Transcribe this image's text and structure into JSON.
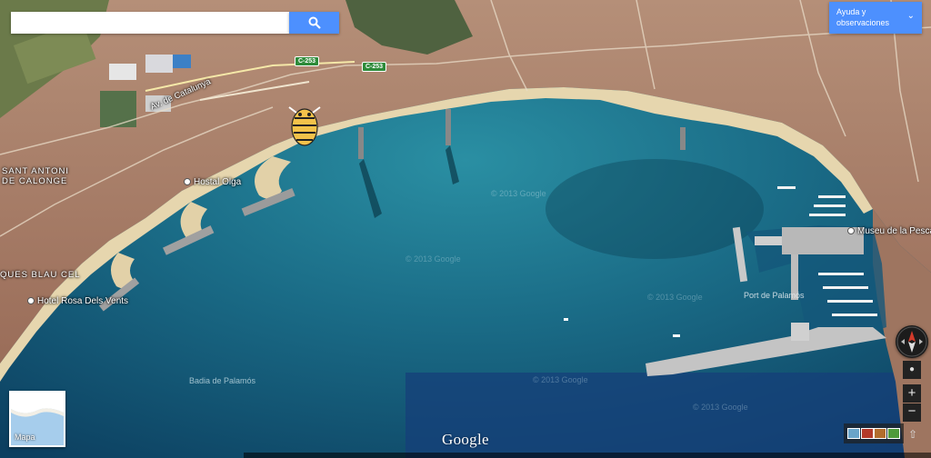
{
  "search": {
    "value": "",
    "placeholder": ""
  },
  "help_button": {
    "label_line1": "Ayuda y",
    "label_line2": "observaciones"
  },
  "road_shields": [
    "C-253",
    "C-253"
  ],
  "places": {
    "avenue": "Av. de Catalunya",
    "town_line1": "SANT ANTONI",
    "town_line2": "DE CALONGE",
    "hostal": "Hostal Olga",
    "hotel": "Hotel Rosa Dels Vents",
    "district": "QUES BLAU CEL",
    "museum": "Museu de la Pesca",
    "port": "Port de Palamós",
    "bay": "Badia de Palamós"
  },
  "watermarks": [
    "© 2013 Google",
    "© 2013 Google",
    "© 2013 Google",
    "© 2013 Google",
    "© 2013 Google"
  ],
  "mini_map": {
    "label": "Mapa"
  },
  "logo": "Google",
  "controls": {
    "zoom_in": "+",
    "zoom_out": "−"
  },
  "colors": {
    "accent": "#4d90fe",
    "sea": "#0e4f6e",
    "beach": "#e6d6ae",
    "town": "#a47a62"
  }
}
